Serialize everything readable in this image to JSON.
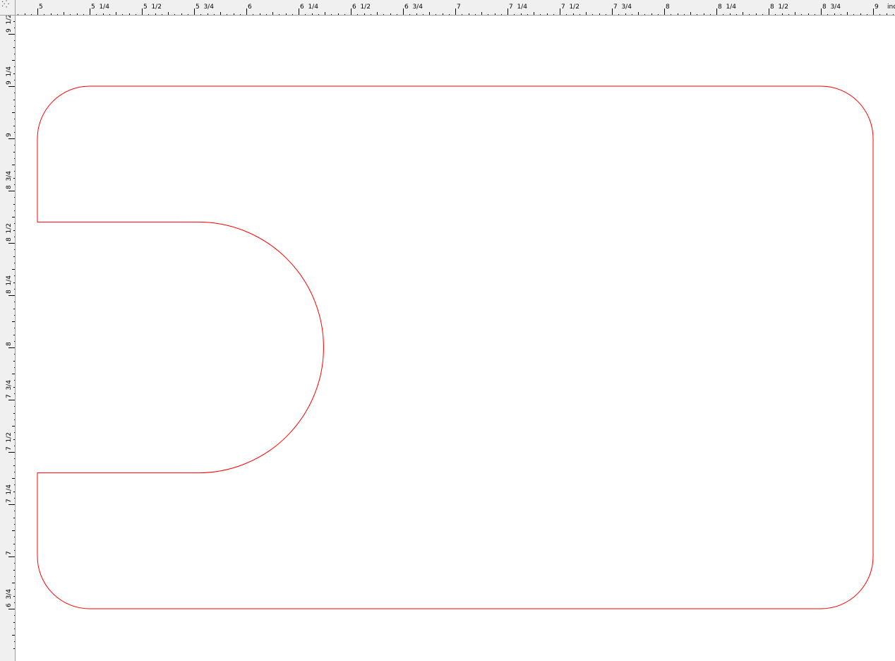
{
  "ruler": {
    "unit_label": "inc",
    "corner_icon": "ruler-origin-icon",
    "horizontal_labels": [
      {
        "value": 5,
        "text": "5"
      },
      {
        "value": 5.25,
        "text": "5  1/4"
      },
      {
        "value": 5.5,
        "text": "5  1/2"
      },
      {
        "value": 5.75,
        "text": "5  3/4"
      },
      {
        "value": 6,
        "text": "6"
      },
      {
        "value": 6.25,
        "text": "6  1/4"
      },
      {
        "value": 6.5,
        "text": "6  1/2"
      },
      {
        "value": 6.75,
        "text": "6  3/4"
      },
      {
        "value": 7,
        "text": "7"
      },
      {
        "value": 7.25,
        "text": "7  1/4"
      },
      {
        "value": 7.5,
        "text": "7  1/2"
      },
      {
        "value": 7.75,
        "text": "7  3/4"
      },
      {
        "value": 8,
        "text": "8"
      },
      {
        "value": 8.25,
        "text": "8  1/4"
      },
      {
        "value": 8.5,
        "text": "8  1/2"
      },
      {
        "value": 8.75,
        "text": "8  3/4"
      },
      {
        "value": 9,
        "text": "9"
      }
    ],
    "vertical_labels": [
      {
        "value": 9.5,
        "text": "9  1/2"
      },
      {
        "value": 9.25,
        "text": "9  1/4"
      },
      {
        "value": 9,
        "text": "9"
      },
      {
        "value": 8.75,
        "text": "8  3/4"
      },
      {
        "value": 8.5,
        "text": "8  1/2"
      },
      {
        "value": 8.25,
        "text": "8  1/4"
      },
      {
        "value": 8,
        "text": "8"
      },
      {
        "value": 7.75,
        "text": "7  3/4"
      },
      {
        "value": 7.5,
        "text": "7  1/2"
      },
      {
        "value": 7.25,
        "text": "7  1/4"
      },
      {
        "value": 7,
        "text": "7"
      },
      {
        "value": 6.75,
        "text": "6  3/4"
      }
    ]
  },
  "shape": {
    "stroke_color": "#ff0000",
    "corner_radius_in": 0.25,
    "left_in": 5,
    "right_in": 9,
    "top_in": 9.25,
    "bottom_in": 6.75,
    "notch_top_in": 8.6,
    "notch_bottom_in": 7.4,
    "notch_arc_start_in": 5.77,
    "notch_arc_extent_in": 6.35
  },
  "colors": {
    "ruler_bg": "#f0f0f0",
    "ruler_tick": "#000000",
    "canvas_bg": "#ffffff"
  }
}
